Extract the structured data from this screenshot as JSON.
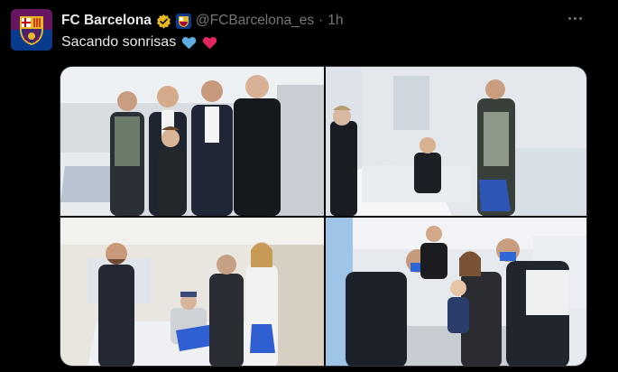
{
  "tweet": {
    "author_name": "FC Barcelona",
    "handle": "@FCBarcelona_es",
    "separator": "·",
    "time": "1h",
    "text": "Sacando sonrisas",
    "emojis": [
      "blue-heart-icon",
      "red-heart-icon"
    ]
  },
  "colors": {
    "background": "#000000",
    "text": "#e7e9ea",
    "muted": "#71767b",
    "verified_gold": "#e8b923",
    "barca_blue": "#0a3a8c",
    "barca_red": "#a50044",
    "blue_heart": "#5dade2",
    "red_heart": "#e0245e"
  },
  "media": {
    "photos": [
      {
        "subject": "players-with-boy-in-hospital-room"
      },
      {
        "subject": "player-with-boy-in-hospital-bed"
      },
      {
        "subject": "players-with-patient-in-bed"
      },
      {
        "subject": "players-with-toddler-and-mother"
      }
    ]
  }
}
